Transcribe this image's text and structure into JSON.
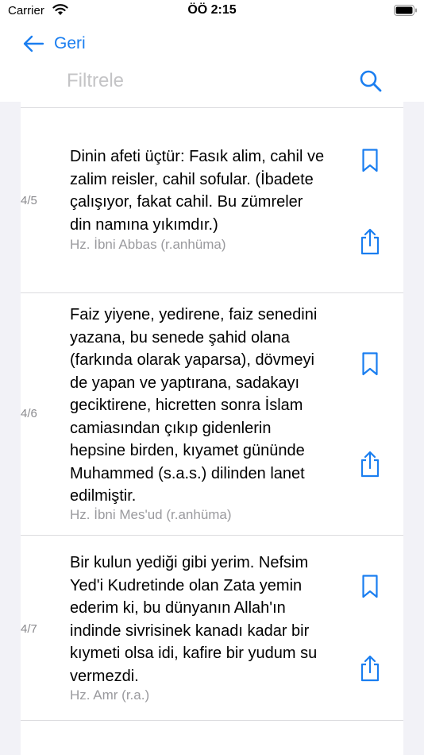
{
  "status": {
    "carrier": "Carrier",
    "time": "ÖÖ 2:15"
  },
  "nav": {
    "back_label": "Geri"
  },
  "filter": {
    "placeholder": "Filtrele"
  },
  "accent_color": "#1a7ef0",
  "quotes": [
    {
      "index": "4/5",
      "lines": [
        "Dinin afeti üçtür: Fasık alim, cahil ve",
        "zalim reisler, cahil sofular. (İbadete",
        "çalışıyor, fakat cahil. Bu zümreler",
        "din namına yıkımdır.)"
      ],
      "author": "Hz. İbni Abbas (r.anhüma)"
    },
    {
      "index": "4/6",
      "lines": [
        "Faiz yiyene, yedirene, faiz senedini",
        "yazana, bu senede şahid olana",
        "(farkında olarak yaparsa), dövmeyi",
        "de yapan ve yaptırana, sadakayı",
        "geciktirene, hicretten sonra İslam",
        "camiasından çıkıp gidenlerin",
        "hepsine birden, kıyamet gününde",
        "Muhammed (s.a.s.) dilinden lanet",
        "edilmiştir."
      ],
      "author": "Hz. İbni Mes'ud (r.anhüma)"
    },
    {
      "index": "4/7",
      "lines": [
        "Bir kulun yediği gibi yerim. Nefsim",
        "Yed'i Kudretinde olan Zata yemin",
        "ederim ki, bu dünyanın Allah'ın",
        "indinde sivrisinek kanadı kadar bir",
        "kıymeti olsa idi, kafire bir yudum su",
        "vermezdi."
      ],
      "author": "Hz. Amr (r.a.)"
    }
  ]
}
